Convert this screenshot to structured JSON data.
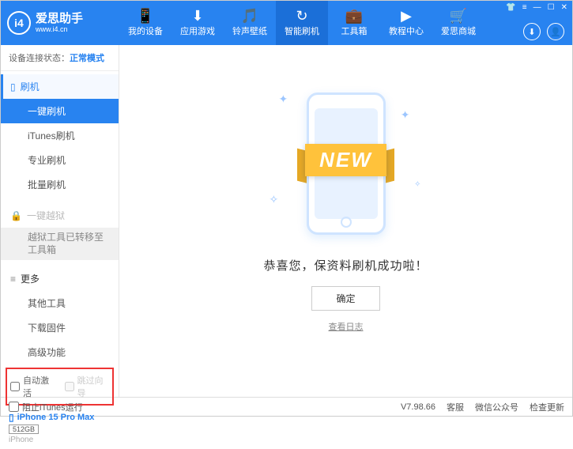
{
  "header": {
    "logo_text": "爱思助手",
    "logo_sub": "www.i4.cn",
    "nav": [
      {
        "icon": "📱",
        "label": "我的设备"
      },
      {
        "icon": "⬇",
        "label": "应用游戏"
      },
      {
        "icon": "🎵",
        "label": "铃声壁纸"
      },
      {
        "icon": "↻",
        "label": "智能刷机"
      },
      {
        "icon": "💼",
        "label": "工具箱"
      },
      {
        "icon": "▶",
        "label": "教程中心"
      },
      {
        "icon": "🛒",
        "label": "爱思商城"
      }
    ]
  },
  "sidebar": {
    "conn_label": "设备连接状态：",
    "conn_mode": "正常模式",
    "flash": {
      "title": "刷机",
      "items": [
        "一键刷机",
        "iTunes刷机",
        "专业刷机",
        "批量刷机"
      ]
    },
    "jailbreak": {
      "title": "一键越狱",
      "note": "越狱工具已转移至工具箱"
    },
    "more": {
      "title": "更多",
      "items": [
        "其他工具",
        "下载固件",
        "高级功能"
      ]
    },
    "checkboxes": {
      "auto_activate": "自动激活",
      "skip_guide": "跳过向导"
    },
    "device": {
      "name": "iPhone 15 Pro Max",
      "storage": "512GB",
      "os": "iPhone"
    }
  },
  "main": {
    "ribbon": "NEW",
    "success": "恭喜您，保资料刷机成功啦！",
    "ok": "确定",
    "view_log": "查看日志"
  },
  "statusbar": {
    "block_itunes": "阻止iTunes运行",
    "version": "V7.98.66",
    "items": [
      "客服",
      "微信公众号",
      "检查更新"
    ]
  }
}
